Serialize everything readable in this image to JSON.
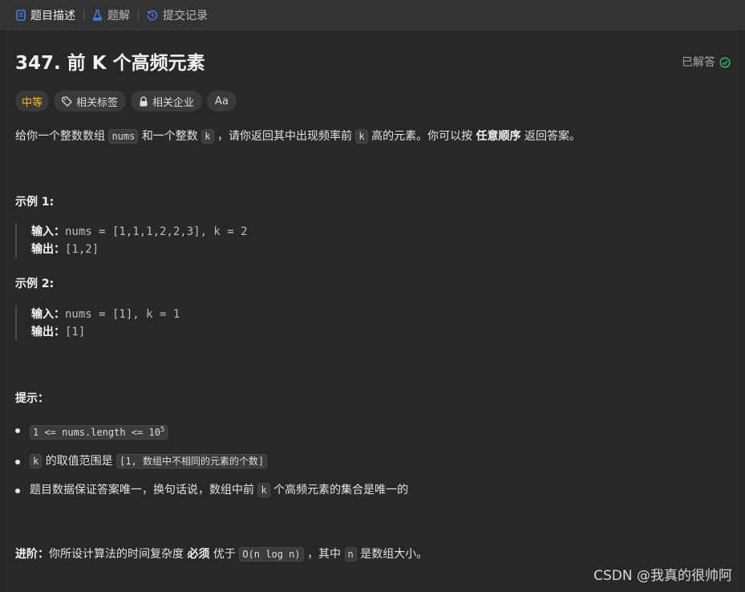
{
  "tabs": [
    {
      "label": "题目描述",
      "icon": "document-icon",
      "color": "#3c7ee8"
    },
    {
      "label": "题解",
      "icon": "flask-icon",
      "color": "#3c7ee8"
    },
    {
      "label": "提交记录",
      "icon": "history-icon",
      "color": "#3c7ee8"
    }
  ],
  "problem": {
    "title": "347. 前 K 个高频元素",
    "status": "已解答",
    "status_color": "#2cbb5d",
    "difficulty": "中等",
    "difficulty_color": "#ffb800",
    "tags": [
      {
        "label": "相关标签",
        "icon": "tag-icon"
      },
      {
        "label": "相关企业",
        "icon": "lock-icon"
      },
      {
        "label": "Aa",
        "icon": "translate-icon"
      }
    ]
  },
  "description": {
    "p1": "给你一个整数数组",
    "c1": "nums",
    "p2": "和一个整数",
    "c2": "k",
    "p3": "，请你返回其中出现频率前",
    "c3": "k",
    "p4": "高的元素。你可以按",
    "b1": "任意顺序",
    "p5": "返回答案。"
  },
  "examples": [
    {
      "title": "示例 1:",
      "input_label": "输入：",
      "input": "nums = [1,1,1,2,2,3], k = 2",
      "output_label": "输出：",
      "output": "[1,2]"
    },
    {
      "title": "示例 2:",
      "input_label": "输入：",
      "input": "nums = [1], k = 1",
      "output_label": "输出：",
      "output": "[1]"
    }
  ],
  "hints": {
    "title": "提示：",
    "h1_code": "1 <= nums.length <= 10",
    "h1_sup": "5",
    "h2_code1": "k",
    "h2_text": "的取值范围是",
    "h2_code2": "[1, 数组中不相同的元素的个数]",
    "h3_text1": "题目数据保证答案唯一，换句话说，数组中前",
    "h3_code": "k",
    "h3_text2": "个高频元素的集合是唯一的"
  },
  "advanced": {
    "label": "进阶：",
    "t1": "你所设计算法的时间复杂度",
    "b1": "必须",
    "t2": "优于",
    "code": "O(n log n)",
    "t3": "，其中",
    "code2": "n",
    "t4": "是数组大小。"
  },
  "watermark": "CSDN @我真的很帅阿"
}
